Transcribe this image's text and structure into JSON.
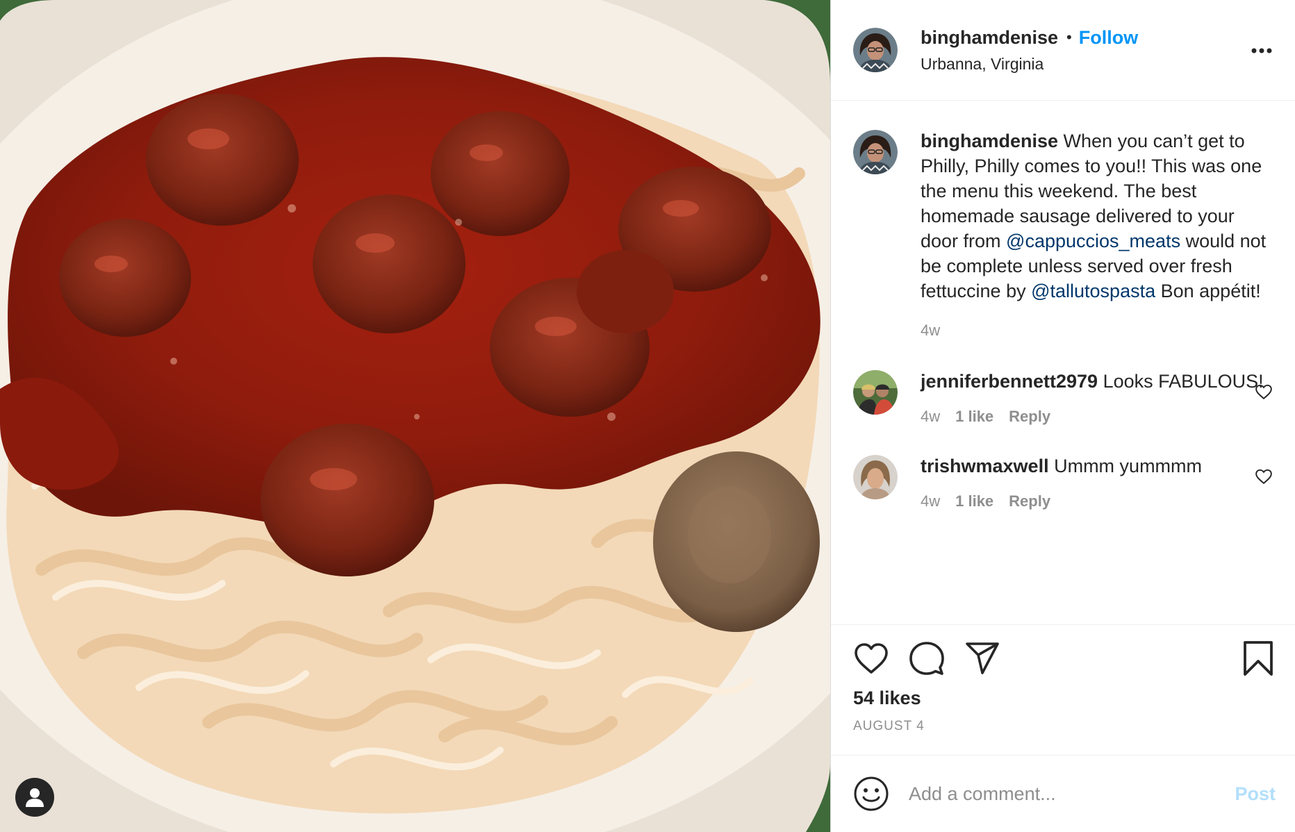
{
  "header": {
    "username": "binghamdenise",
    "separator": "•",
    "follow_label": "Follow",
    "location": "Urbanna, Virginia",
    "more_icon": "more-options-icon"
  },
  "caption": {
    "username": "binghamdenise",
    "text_1": " When you can’t get to Philly, Philly comes to you!! This was one the menu this weekend. The best homemade sausage delivered to your door from ",
    "mention_1": "@cappuccios_meats",
    "text_2": " would not be complete unless served over fresh fettuccine by ",
    "mention_2": "@tallutospasta",
    "text_3": " Bon appétit!",
    "time": "4w"
  },
  "comments": [
    {
      "username": "jenniferbennett2979",
      "text": " Looks FABULOUS!",
      "time": "4w",
      "likes": "1 like",
      "reply": "Reply"
    },
    {
      "username": "trishwmaxwell",
      "text": " Ummm yummmm",
      "time": "4w",
      "likes": "1 like",
      "reply": "Reply"
    }
  ],
  "actions": {
    "like_icon": "heart-icon",
    "comment_icon": "comment-icon",
    "share_icon": "share-icon",
    "save_icon": "bookmark-icon",
    "likes_count": "54 likes",
    "date": "AUGUST 4"
  },
  "add_comment": {
    "placeholder": "Add a comment...",
    "post_label": "Post"
  },
  "colors": {
    "link_blue": "#0095f6",
    "mention_blue": "#00376b",
    "muted_gray": "#8e8e8e",
    "post_disabled": "#b2dffc"
  }
}
